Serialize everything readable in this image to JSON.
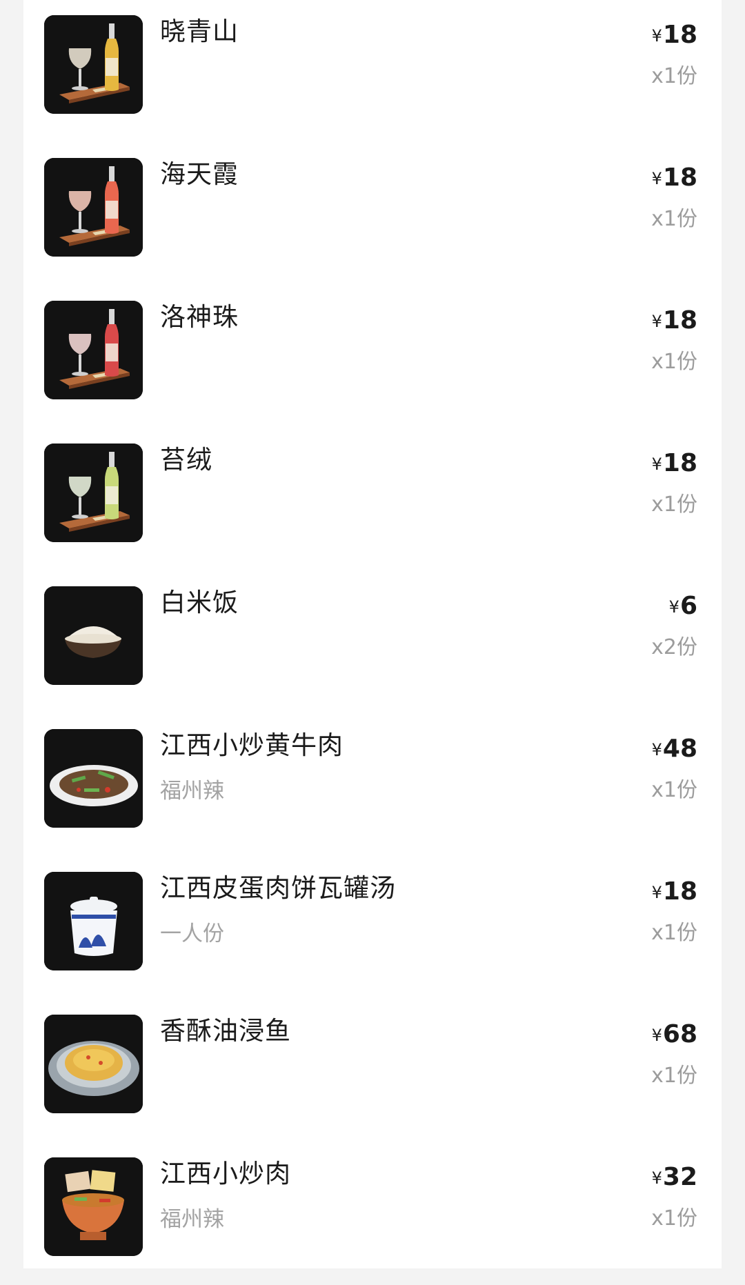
{
  "currency_symbol": "¥",
  "items": [
    {
      "name": "晓青山",
      "sub": "",
      "price": "18",
      "qty": "x1份",
      "icon": "drink-bottle-icon",
      "accent": "#e6b840",
      "glass": "#e8e0d0"
    },
    {
      "name": "海天霞",
      "sub": "",
      "price": "18",
      "qty": "x1份",
      "icon": "drink-bottle-icon",
      "accent": "#e9674f",
      "glass": "#f2c7b8"
    },
    {
      "name": "洛神珠",
      "sub": "",
      "price": "18",
      "qty": "x1份",
      "icon": "drink-bottle-icon",
      "accent": "#d94a4a",
      "glass": "#f1d5d3"
    },
    {
      "name": "苔绒",
      "sub": "",
      "price": "18",
      "qty": "x1份",
      "icon": "drink-bottle-icon",
      "accent": "#c8d97a",
      "glass": "#e7eedc"
    },
    {
      "name": "白米饭",
      "sub": "",
      "price": "6",
      "qty": "x2份",
      "icon": "rice-bowl-icon"
    },
    {
      "name": "江西小炒黄牛肉",
      "sub": "福州辣",
      "price": "48",
      "qty": "x1份",
      "icon": "beef-plate-icon"
    },
    {
      "name": "江西皮蛋肉饼瓦罐汤",
      "sub": "一人份",
      "price": "18",
      "qty": "x1份",
      "icon": "soup-jar-icon"
    },
    {
      "name": "香酥油浸鱼",
      "sub": "",
      "price": "68",
      "qty": "x1份",
      "icon": "fish-plate-icon"
    },
    {
      "name": "江西小炒肉",
      "sub": "福州辣",
      "price": "32",
      "qty": "x1份",
      "icon": "pork-bowl-icon"
    }
  ]
}
